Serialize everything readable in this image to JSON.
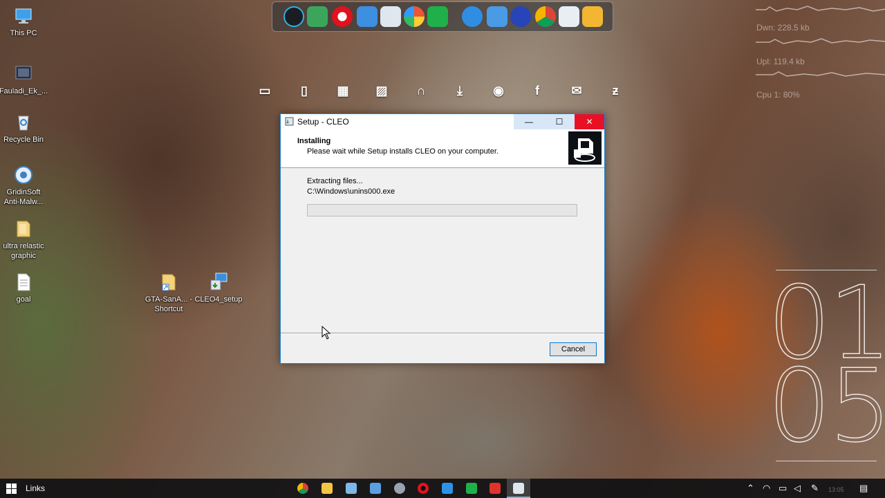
{
  "desktop": {
    "icons": [
      {
        "label": "This PC",
        "icon": "monitor-icon"
      },
      {
        "label": "Fauladi_Ek_...",
        "icon": "video-file-icon"
      },
      {
        "label": "Recycle Bin",
        "icon": "recycle-bin-icon"
      },
      {
        "label": "GridinSoft Anti-Malw...",
        "icon": "anti-malware-icon"
      },
      {
        "label": "ultra relastic graphic",
        "icon": "folder-icon"
      },
      {
        "label": "goal",
        "icon": "text-file-icon"
      },
      {
        "label": "GTA-SanA... - Shortcut",
        "icon": "shortcut-folder-icon"
      },
      {
        "label": "CLEO4_setup",
        "icon": "installer-icon"
      }
    ]
  },
  "widgets": {
    "down": "Dwn: 228.5 kb",
    "up": "Upl: 119.4 kb",
    "cpu": "Cpu 1: 80%",
    "clock_hour": "01",
    "clock_minute": "05"
  },
  "dialog": {
    "title": "Setup - CLEO",
    "heading": "Installing",
    "subheading": "Please wait while Setup installs CLEO on your computer.",
    "status": "Extracting files...",
    "current_file": "C:\\Windows\\unins000.exe",
    "progress_percent": 0,
    "cancel_label": "Cancel",
    "minimize_glyph": "—",
    "maximize_glyph": "☐",
    "close_glyph": "✕"
  },
  "taskbar": {
    "toolbar_label": "Links",
    "time": "13:05"
  },
  "colors": {
    "accent": "#0078d7",
    "close_red": "#e81123"
  }
}
